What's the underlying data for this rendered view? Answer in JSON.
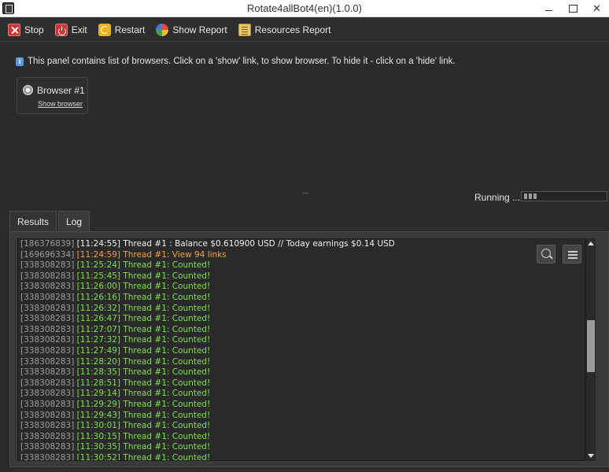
{
  "window": {
    "title": "Rotate4allBot4(en)(1.0.0)",
    "close_glyph": "✕"
  },
  "toolbar": {
    "stop_label": "Stop",
    "exit_label": "Exit",
    "restart_label": "Restart",
    "show_report_label": "Show Report",
    "resources_report_label": "Resources Report"
  },
  "browsers_panel": {
    "info_text": "This panel contains list of browsers. Click on a 'show' link, to show browser. To hide it - click on a 'hide' link.",
    "info_icon": "i",
    "browser_name": "Browser #1",
    "show_link": "Show browser",
    "splitter_glyph": "......"
  },
  "status": {
    "text": "Running ...",
    "progress": "indeterminate"
  },
  "tabs": [
    {
      "label": "Results"
    },
    {
      "label": "Log"
    }
  ],
  "active_tab": "Log",
  "log": [
    {
      "id": "[186376839]",
      "text": "[11:24:55] Thread #1 : Balance $0.610900 USD // Today earnings $0.14 USD",
      "color": "white"
    },
    {
      "id": "[169696334]",
      "text": "[11:24:59] Thread #1: View 94 links",
      "color": "orange"
    },
    {
      "id": "[338308283]",
      "text": "[11:25:24] Thread #1: Counted!",
      "color": "green"
    },
    {
      "id": "[338308283]",
      "text": "[11:25:45] Thread #1: Counted!",
      "color": "green"
    },
    {
      "id": "[338308283]",
      "text": "[11:26:00] Thread #1: Counted!",
      "color": "green"
    },
    {
      "id": "[338308283]",
      "text": "[11:26:16] Thread #1: Counted!",
      "color": "green"
    },
    {
      "id": "[338308283]",
      "text": "[11:26:32] Thread #1: Counted!",
      "color": "green"
    },
    {
      "id": "[338308283]",
      "text": "[11:26:47] Thread #1: Counted!",
      "color": "green"
    },
    {
      "id": "[338308283]",
      "text": "[11:27:07] Thread #1: Counted!",
      "color": "green"
    },
    {
      "id": "[338308283]",
      "text": "[11:27:32] Thread #1: Counted!",
      "color": "green"
    },
    {
      "id": "[338308283]",
      "text": "[11:27:49] Thread #1: Counted!",
      "color": "green"
    },
    {
      "id": "[338308283]",
      "text": "[11:28:20] Thread #1: Counted!",
      "color": "green"
    },
    {
      "id": "[338308283]",
      "text": "[11:28:35] Thread #1: Counted!",
      "color": "green"
    },
    {
      "id": "[338308283]",
      "text": "[11:28:51] Thread #1: Counted!",
      "color": "green"
    },
    {
      "id": "[338308283]",
      "text": "[11:29:14] Thread #1: Counted!",
      "color": "green"
    },
    {
      "id": "[338308283]",
      "text": "[11:29:29] Thread #1: Counted!",
      "color": "green"
    },
    {
      "id": "[338308283]",
      "text": "[11:29:43] Thread #1: Counted!",
      "color": "green"
    },
    {
      "id": "[338308283]",
      "text": "[11:30:01] Thread #1: Counted!",
      "color": "green"
    },
    {
      "id": "[338308283]",
      "text": "[11:30:15] Thread #1: Counted!",
      "color": "green"
    },
    {
      "id": "[338308283]",
      "text": "[11:30:35] Thread #1: Counted!",
      "color": "green"
    },
    {
      "id": "[338308283]",
      "text": "[11:30:52] Thread #1: Counted!",
      "color": "green"
    }
  ],
  "colors": {
    "log_green": "#7ee04a",
    "log_orange": "#f0a23a",
    "log_white": "#f0f0f0",
    "background": "#2b2b2b"
  }
}
